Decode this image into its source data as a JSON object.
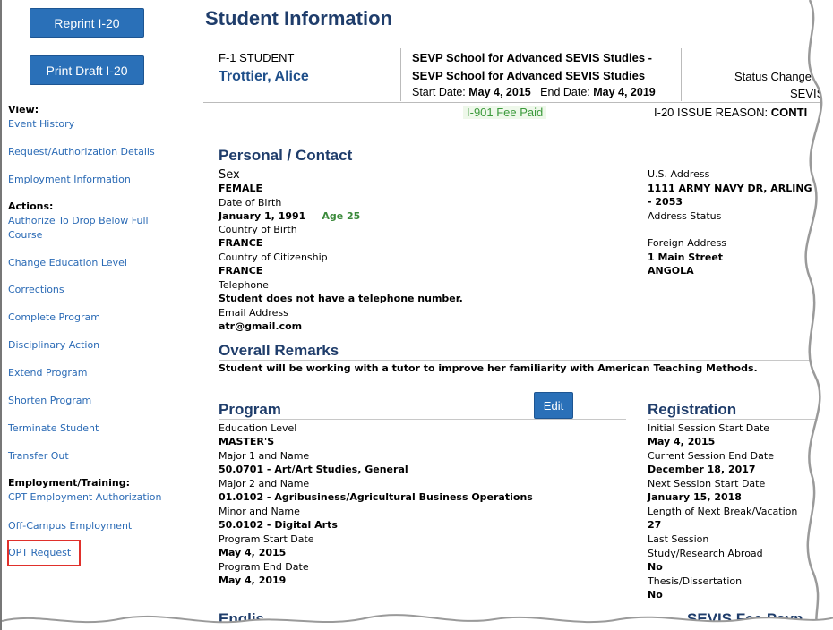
{
  "sidebar": {
    "reprint_label": "Reprint I-20",
    "print_draft_label": "Print Draft I-20",
    "view_heading": "View:",
    "view_items": [
      "Event History",
      "Request/Authorization Details",
      "Employment Information"
    ],
    "actions_heading": "Actions:",
    "action_items": [
      "Authorize To Drop Below Full Course",
      "Change Education Level",
      "Corrections",
      "Complete Program",
      "Disciplinary Action",
      "Extend Program",
      "Shorten Program",
      "Terminate Student",
      "Transfer Out"
    ],
    "employment_heading": "Employment/Training:",
    "employment_items": [
      "CPT Employment Authorization",
      "Off-Campus Employment",
      "OPT Request"
    ]
  },
  "main": {
    "title": "Student Information",
    "student_type": "F-1 STUDENT",
    "student_name": "Trottier, Alice",
    "school_line_1": "SEVP School for Advanced SEVIS Studies -",
    "school_line_2": "SEVP School for Advanced SEVIS Studies",
    "start_date_label": "Start Date:",
    "start_date": "May 4, 2015",
    "end_date_label": "End Date:",
    "end_date": "May 4, 2019",
    "status_change": "Status Change D",
    "sevis_short": "SEVIS",
    "fee_paid": "I-901 Fee Paid",
    "issue_reason_label": "I-20 ISSUE REASON:",
    "issue_reason_value": "CONTI"
  },
  "personal": {
    "title": "Personal / Contact",
    "sex_label": "Sex",
    "sex": "FEMALE",
    "dob_label": "Date of Birth",
    "dob": "January 1, 1991",
    "age": "Age 25",
    "cob_label": "Country of Birth",
    "cob": "FRANCE",
    "coc_label": "Country of Citizenship",
    "coc": "FRANCE",
    "tel_label": "Telephone",
    "tel": "Student does not have a telephone number.",
    "email_label": "Email Address",
    "email": "atr@gmail.com",
    "us_address_label": "U.S. Address",
    "us_address_1": "1111 ARMY NAVY DR,  ARLING",
    "us_address_2": " - 2053",
    "address_status_label": "Address Status",
    "foreign_address_label": "Foreign Address",
    "foreign_address_1": "1 Main Street",
    "foreign_address_2": "ANGOLA"
  },
  "remarks": {
    "title": "Overall Remarks",
    "text": "Student will be working with a tutor to improve her familiarity with American Teaching Methods."
  },
  "program": {
    "title": "Program",
    "edit_label": "Edit",
    "edu_level_label": "Education Level",
    "edu_level": "MASTER'S",
    "major1_label": "Major 1 and Name",
    "major1": "50.0701 - Art/Art Studies, General",
    "major2_label": "Major 2 and Name",
    "major2": "01.0102 - Agribusiness/Agricultural Business Operations",
    "minor_label": "Minor and Name",
    "minor": "50.0102 - Digital Arts",
    "start_label": "Program Start Date",
    "start": "May 4, 2015",
    "end_label": "Program End Date",
    "end": "May 4, 2019"
  },
  "registration": {
    "title": "Registration",
    "init_start_label": "Initial Session Start Date",
    "init_start": "May 4, 2015",
    "cur_end_label": "Current Session End Date",
    "cur_end": "December 18, 2017",
    "next_start_label": "Next Session Start Date",
    "next_start": "January 15, 2018",
    "break_label": "Length of Next Break/Vacation",
    "break": "27",
    "last_session_label": "Last Session",
    "study_abroad_label": "Study/Research Abroad",
    "study_abroad": "No",
    "thesis_label": "Thesis/Dissertation",
    "thesis": "No"
  },
  "bottom": {
    "english_title": "Englis",
    "sevis_fee_title": "SEVIS Fee Payn"
  },
  "colors": {
    "link": "#2a6ab5",
    "heading": "#1f3d6b",
    "button": "#2a70b8",
    "highlight": "#e0302b",
    "fee_green": "#3b9a3b"
  }
}
